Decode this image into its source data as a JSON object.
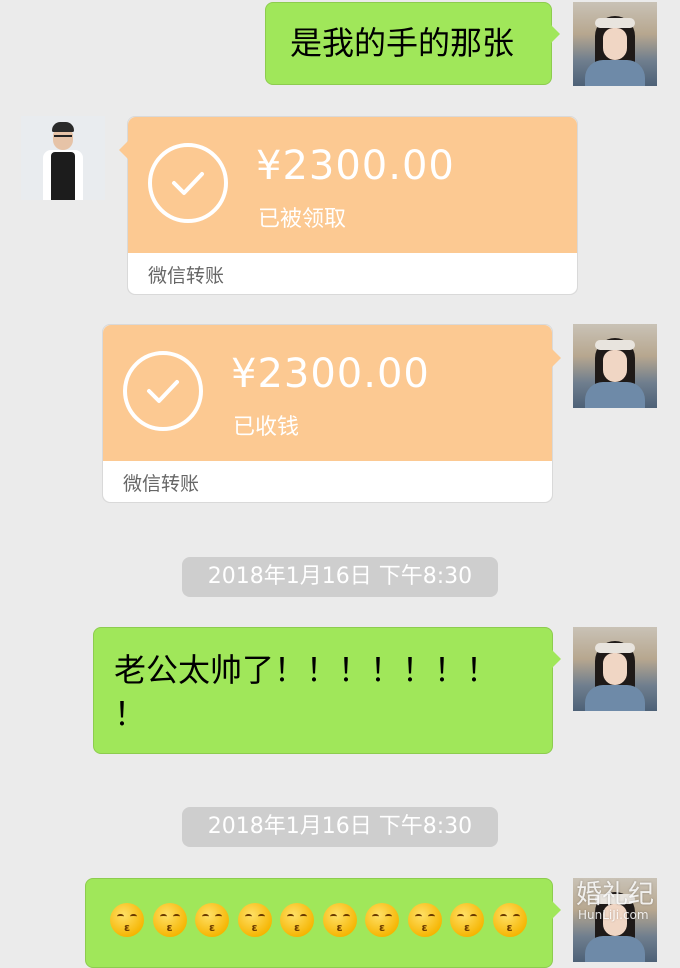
{
  "messages": {
    "m1_text": "是我的手的那张",
    "transfer1": {
      "amount": "¥2300.00",
      "status": "已被领取",
      "label": "微信转账"
    },
    "transfer2": {
      "amount": "¥2300.00",
      "status": "已收钱",
      "label": "微信转账"
    },
    "timestamp1": "2018年1月16日 下午8:30",
    "m2_line1": "老公太帅了！！！！！！！",
    "m2_line2": "！",
    "timestamp2": "2018年1月16日 下午8:30",
    "m3_emoji_count": 10,
    "m3_emoji_icon": "kissing-face-emoji"
  },
  "watermark": {
    "main": "婚礼纪",
    "sub": "HunLiJi.com"
  },
  "colors": {
    "background": "#ebebeb",
    "bubble_green": "#a0e75a",
    "transfer_orange": "#fcc992",
    "timestamp_pill": "#cecece"
  }
}
